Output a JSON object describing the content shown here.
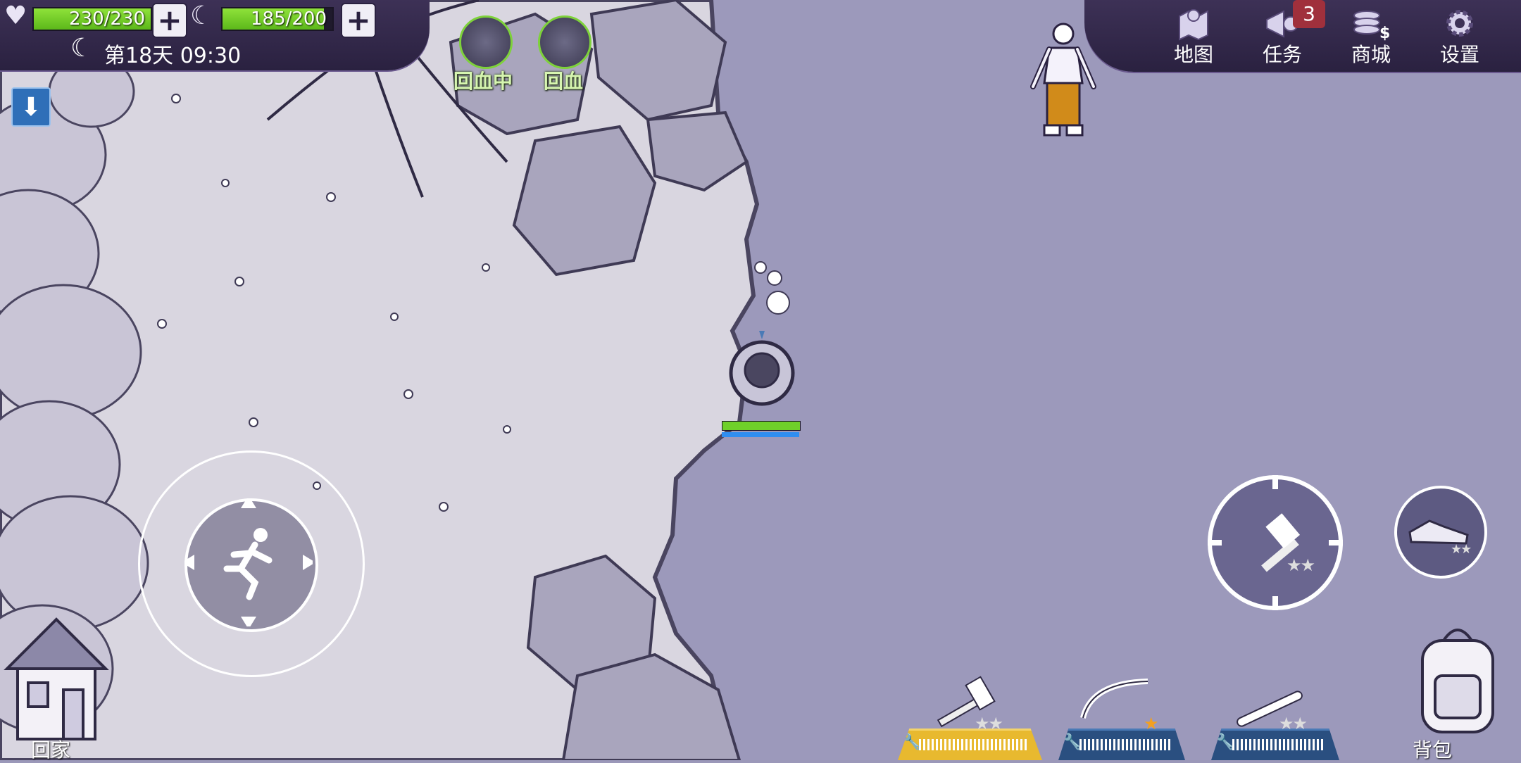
{
  "stats": {
    "health": {
      "text": "230/230",
      "fraction": 1.0
    },
    "hunger": {
      "text": "185/200",
      "fraction": 0.925
    }
  },
  "time": {
    "day_time": "第18天 09:30"
  },
  "status_effects": [
    {
      "label": "回血中"
    },
    {
      "label": "回血"
    }
  ],
  "menu": {
    "map": "地图",
    "quests": "任务",
    "quests_badge": "3",
    "shop": "商城",
    "settings": "设置"
  },
  "bottom": {
    "home": "回家",
    "backpack": "背包"
  },
  "player": {
    "health_fraction": 1.0,
    "stamina_fraction": 1.0
  },
  "weapon_slots": [
    {
      "item": "stone-hammer",
      "stars": 2,
      "active": true
    },
    {
      "item": "bow",
      "stars": 1,
      "active": false
    },
    {
      "item": "spiked-club",
      "stars": 2,
      "active": false
    }
  ],
  "attack_weapon_stars": 2,
  "dodge_item_stars": 2,
  "colors": {
    "health": "#6fd02a",
    "stamina": "#2f8ef0",
    "slot_active": "#e8b92f",
    "slot": "#2a4f80"
  }
}
